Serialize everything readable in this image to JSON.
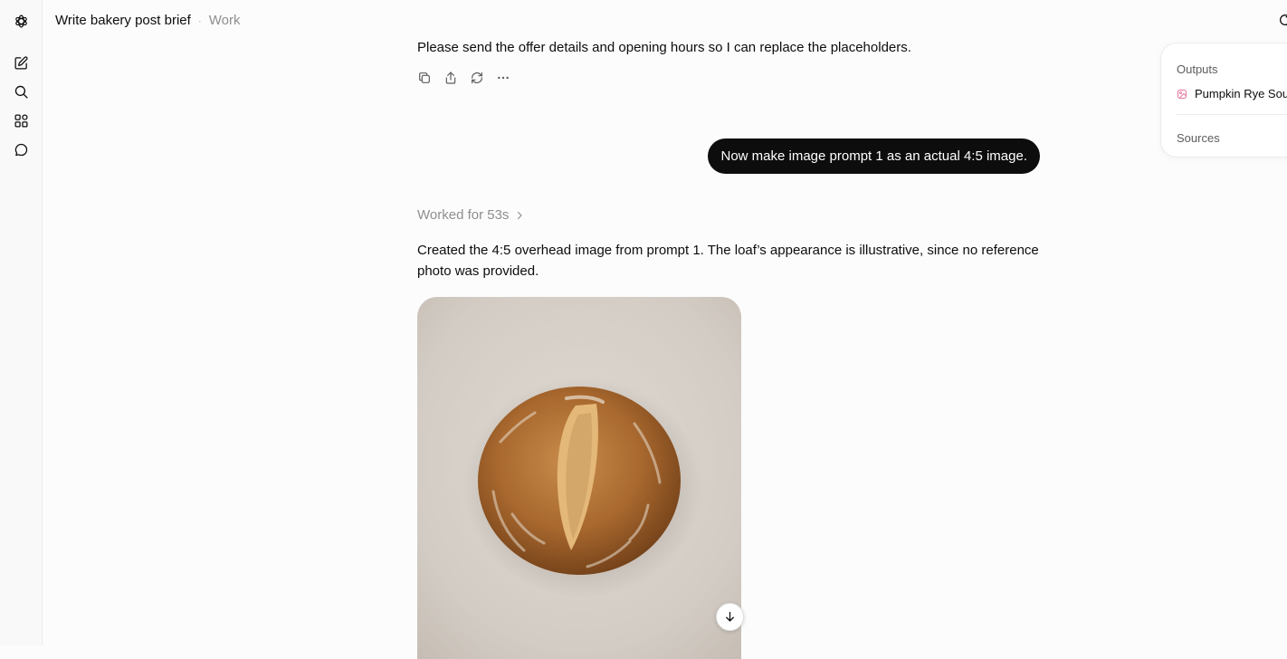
{
  "header": {
    "title": "Write bakery post brief",
    "separator": "·",
    "project": "Work"
  },
  "sidebar": {
    "items": [
      {
        "icon": "logo-icon",
        "label": ""
      },
      {
        "icon": "new-chat-icon",
        "label": ""
      },
      {
        "icon": "search-icon",
        "label": ""
      },
      {
        "icon": "apps-icon",
        "label": ""
      },
      {
        "icon": "chat-bubble-icon",
        "label": ""
      }
    ]
  },
  "conversation": {
    "assistant_message_1": "Please send the offer details and opening hours so I can replace the placeholders.",
    "message_actions": [
      "copy-icon",
      "share-icon",
      "regenerate-icon",
      "more-icon"
    ],
    "user_message": "Now make image prompt 1 as an actual 4:5 image.",
    "worked_label": "Worked for 53s",
    "assistant_message_2": "Created the 4:5 overhead image from prompt 1. The loaf’s appearance is illustrative, since no reference photo was provided.",
    "image": {
      "icon": "download-icon"
    }
  },
  "side_panel": {
    "outputs_heading": "Outputs",
    "output_item": "Pumpkin Rye Sou",
    "output_icon": "image-file-icon",
    "sources_heading": "Sources"
  },
  "colors": {
    "user_bubble": "#0d0d0d",
    "muted_text": "#8f8f8f",
    "output_icon": "#e8769b"
  }
}
